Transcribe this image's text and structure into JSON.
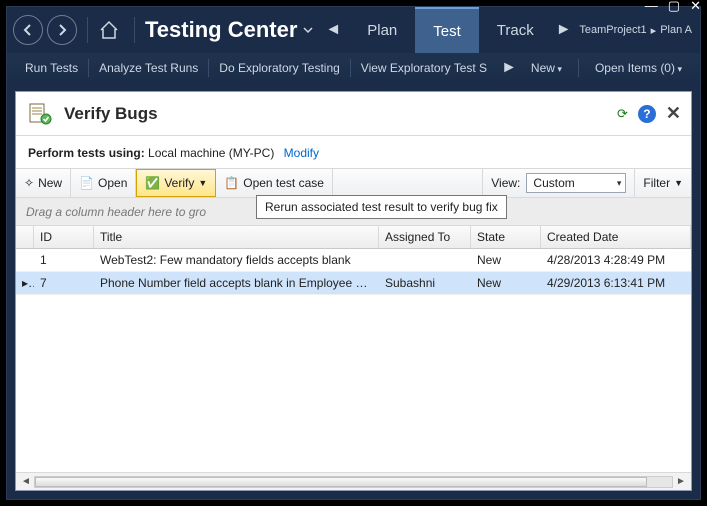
{
  "window": {
    "title": "Testing Center",
    "breadcrumb_project": "TeamProject1",
    "breadcrumb_plan": "Plan A"
  },
  "tabs": {
    "items": [
      "Plan",
      "Test",
      "Track"
    ],
    "active_index": 1
  },
  "subbar": {
    "items": [
      "Run Tests",
      "Analyze Test Runs",
      "Do Exploratory Testing",
      "View Exploratory Test S"
    ],
    "new_label": "New",
    "open_items_label": "Open Items (0)"
  },
  "panel": {
    "title": "Verify Bugs",
    "context_label": "Perform tests using:",
    "context_value": "Local machine (MY-PC)",
    "modify_label": "Modify"
  },
  "toolbar": {
    "new_label": "New",
    "open_label": "Open",
    "verify_label": "Verify",
    "open_test_case_label": "Open test case",
    "view_label": "View:",
    "view_value": "Custom",
    "filter_label": "Filter"
  },
  "tooltip": "Rerun associated test result to verify bug fix",
  "group_header_text": "Drag a column header here to gro",
  "grid": {
    "columns": {
      "id": "ID",
      "title": "Title",
      "assigned": "Assigned To",
      "state": "State",
      "date": "Created Date"
    },
    "rows": [
      {
        "id": "1",
        "title": "WebTest2: Few mandatory fields accepts blank",
        "assigned": "",
        "state": "New",
        "date": "4/28/2013 4:28:49 PM",
        "selected": false
      },
      {
        "id": "7",
        "title": "Phone Number field accepts blank in Employee Detail…",
        "assigned": "Subashni",
        "state": "New",
        "date": "4/29/2013 6:13:41 PM",
        "selected": true
      }
    ]
  }
}
